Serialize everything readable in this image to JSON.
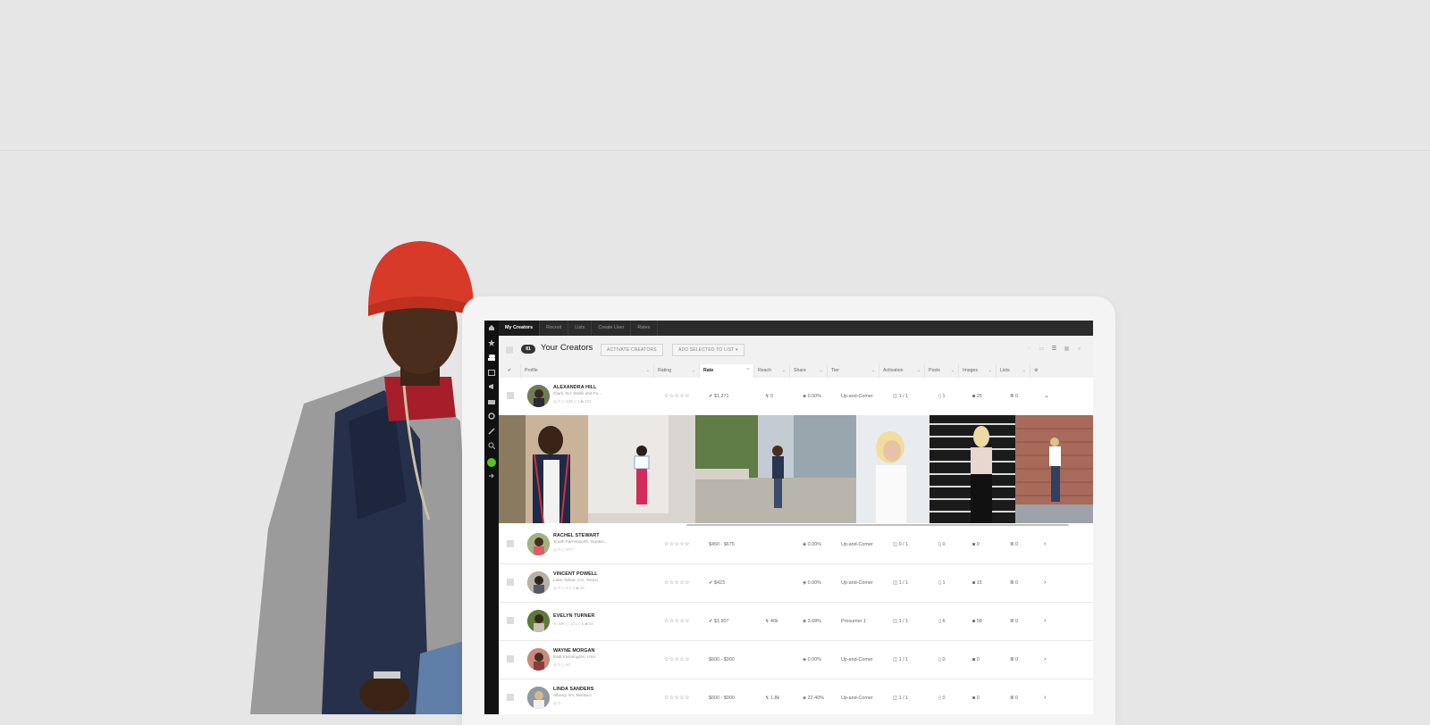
{
  "nav": {
    "tabs": [
      "My Creators",
      "Recruit",
      "Lists",
      "Create User",
      "Rates"
    ],
    "active_tab": "My Creators"
  },
  "rail_icons": [
    "home-icon",
    "star-icon",
    "users-icon",
    "calendar-icon",
    "megaphone-icon",
    "mail-icon",
    "gear-icon",
    "link-icon",
    "search-icon",
    "status-online-icon",
    "logout-icon"
  ],
  "header": {
    "count": "81",
    "title": "Your Creators",
    "activate_label": "ACTIVATE CREATORS",
    "add_list_label": "ADD SELECTED TO LIST ▾",
    "view_icons": [
      "tag-icon",
      "card-view-icon",
      "list-view-icon",
      "grid-view-icon",
      "search-icon"
    ]
  },
  "columns": [
    "Profile",
    "Rating",
    "Rate",
    "Reach",
    "Share",
    "Tier",
    "Activation",
    "Posts",
    "Images",
    "Lists"
  ],
  "sorted_column": "Rate",
  "rows": [
    {
      "name": "ALEXANDRA HILL",
      "location": "Clark, NJ, Wells and Fu...",
      "stats": "◎ 0  ◻ 125  ▯ 1  ◙ 103",
      "rating": "☆☆☆☆☆",
      "rate": "✔ $1,271",
      "reach": "↯ 0",
      "share": "◈ 0.00%",
      "tier": "Up-and-Comer",
      "activation": "◫ 1 / 1",
      "posts": "▯ 1",
      "images": "◙ 25",
      "lists": "≣ 0",
      "expand": "⌄"
    },
    {
      "name": "RACHEL STEWART",
      "location": "South Farmsworth, Rankin...",
      "stats": "◎ 0  ◻ 277",
      "rating": "☆☆☆☆☆",
      "rate": "$450 - $675",
      "reach": "",
      "share": "◈ 0.00%",
      "tier": "Up-and-Comer",
      "activation": "◫ 0 / 1",
      "posts": "▯ 0",
      "images": "◙ 0",
      "lists": "≣ 0",
      "expand": "›"
    },
    {
      "name": "VINCENT POWELL",
      "location": "Lake Tahoe, CA, Yeravi",
      "stats": "◎ 0  ◻ 0  ▯ 1  ◙ 15",
      "rating": "☆☆☆☆☆",
      "rate": "✔ $423",
      "reach": "",
      "share": "◈ 0.00%",
      "tier": "Up-and-Comer",
      "activation": "◫ 1 / 1",
      "posts": "▯ 1",
      "images": "◙ 15",
      "lists": "≣ 0",
      "expand": "›"
    },
    {
      "name": "EVELYN TURNER",
      "location": "",
      "stats": "◎ 40k  ◻ 171  ▯ 6  ◙ 58",
      "rating": "☆☆☆☆☆",
      "rate": "✔ $1,907",
      "reach": "↯ 40k",
      "share": "◈ 3.68%",
      "tier": "Prosumer 1",
      "activation": "◫ 1 / 1",
      "posts": "▯ 6",
      "images": "◙ 58",
      "lists": "≣ 0",
      "expand": "›"
    },
    {
      "name": "WAYNE MORGAN",
      "location": "East Farmington, USA",
      "stats": "◎ 0  ◻ 57",
      "rating": "☆☆☆☆☆",
      "rate": "$600 - $900",
      "reach": "",
      "share": "◈ 0.00%",
      "tier": "Up-and-Comer",
      "activation": "◫ 1 / 1",
      "posts": "▯ 0",
      "images": "◙ 0",
      "lists": "≣ 0",
      "expand": "›"
    },
    {
      "name": "LINDA SANDERS",
      "location": "Albany, NY, Monaco",
      "stats": "◎ 0",
      "rating": "☆☆☆☆☆",
      "rate": "$600 - $900",
      "reach": "↯ 1.8k",
      "share": "◈ 22.40%",
      "tier": "Up-and-Comer",
      "activation": "◫ 1 / 1",
      "posts": "▯ 0",
      "images": "◙ 0",
      "lists": "≣ 0",
      "expand": "›"
    }
  ]
}
